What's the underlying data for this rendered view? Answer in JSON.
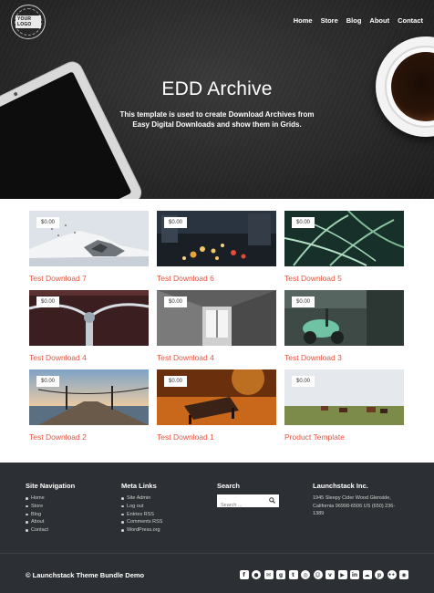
{
  "header": {
    "logo_text": "YOUR LOGO",
    "nav": [
      "Home",
      "Store",
      "Blog",
      "About",
      "Contact"
    ]
  },
  "hero": {
    "title": "EDD Archive",
    "subtitle": "This template is used to create Download Archives from Easy Digital Downloads and show them in Grids."
  },
  "downloads": [
    {
      "title": "Test Download 7",
      "price": "$0.00",
      "image": "snowy-mountain"
    },
    {
      "title": "Test Download 6",
      "price": "$0.00",
      "image": "city-traffic-night"
    },
    {
      "title": "Test Download 5",
      "price": "$0.00",
      "image": "fern-leaves"
    },
    {
      "title": "Test Download 4",
      "price": "$0.00",
      "image": "bicycle-handlebar"
    },
    {
      "title": "Test Download 4",
      "price": "$0.00",
      "image": "attic-window"
    },
    {
      "title": "Test Download 3",
      "price": "$0.00",
      "image": "green-scooter"
    },
    {
      "title": "Test Download 2",
      "price": "$0.00",
      "image": "wooden-pier"
    },
    {
      "title": "Test Download 1",
      "price": "$0.00",
      "image": "autumn-bench"
    },
    {
      "title": "Product Template",
      "price": "$0.00",
      "image": "horses-field"
    }
  ],
  "footer": {
    "site_navigation": {
      "heading": "Site Navigation",
      "links": [
        "Home",
        "Store",
        "Blog",
        "About",
        "Contact"
      ]
    },
    "meta_links": {
      "heading": "Meta Links",
      "links": [
        "Site Admin",
        "Log out",
        "Entries RSS",
        "Comments RSS",
        "WordPress.org"
      ]
    },
    "search": {
      "heading": "Search",
      "placeholder": "Search ..."
    },
    "company": {
      "heading": "Launchstack Inc.",
      "address": "1945 Sleepy Cider Wood Glenside, California 96998-6506 US (650) 236-1389"
    },
    "copyright": "© Launchstack Theme Bundle Demo",
    "social_icons": [
      "facebook-icon",
      "github-icon",
      "mail-icon",
      "google-plus-icon",
      "tumblr-icon",
      "dribbble-icon",
      "reddit-icon",
      "vimeo-icon",
      "youtube-icon",
      "linkedin-icon",
      "soundcloud-icon",
      "pinterest-icon",
      "flickr-icon",
      "rss-icon"
    ]
  }
}
